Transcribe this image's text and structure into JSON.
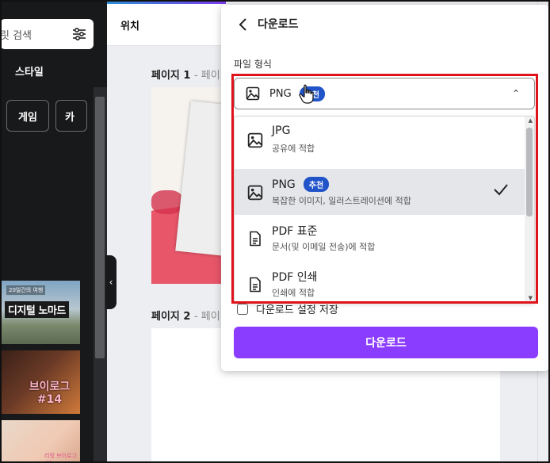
{
  "sidebar": {
    "search_placeholder": "릿 검색",
    "style_heading": "스타일",
    "chips": [
      "게임",
      "카"
    ],
    "templates": [
      {
        "tag": "20일간의 여행",
        "title": "디지털 노마드"
      },
      {
        "title": "브이로그 #14"
      },
      {
        "title": "리빙 브이로그 #?"
      }
    ]
  },
  "topbar": {
    "label": "위치"
  },
  "canvas": {
    "page1_label": "페이지 1",
    "page1_suffix": "- 페이",
    "page2_label": "페이지 2",
    "page2_suffix": "- 페이"
  },
  "download_panel": {
    "title": "다운로드",
    "format_label": "파일 형식",
    "selected_format": "PNG",
    "recommended_badge": "추천",
    "options": [
      {
        "name": "JPG",
        "desc": "공유에 적합",
        "badge": null,
        "selected": false
      },
      {
        "name": "PNG",
        "desc": "복잡한 이미지, 일러스트레이션에 적합",
        "badge": "추천",
        "selected": true
      },
      {
        "name": "PDF 표준",
        "desc": "문서(및 이메일 전송)에 적합",
        "badge": null,
        "selected": false
      },
      {
        "name": "PDF 인쇄",
        "desc": "인쇄에 적합",
        "badge": null,
        "selected": false
      }
    ],
    "save_settings_label": "다운로드 설정 저장",
    "download_button": "다운로드"
  },
  "colors": {
    "accent_purple": "#8b3dff",
    "badge_blue": "#2153c9",
    "highlight_red": "#e0121a",
    "dark_panel": "#18191b"
  }
}
